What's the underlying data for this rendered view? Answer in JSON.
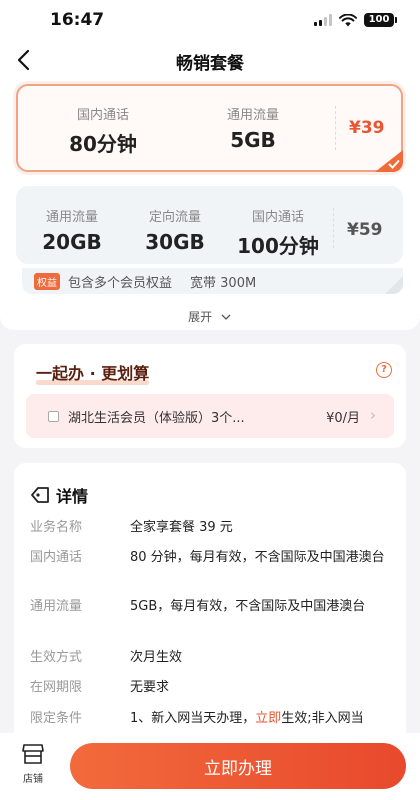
{
  "status_bar": {
    "time": "16:47",
    "battery": "100"
  },
  "nav": {
    "title": "畅销套餐"
  },
  "plans": [
    {
      "selected": true,
      "price": "¥39",
      "items": [
        {
          "label": "国内通话",
          "value": "80分钟"
        },
        {
          "label": "通用流量",
          "value": "5GB"
        }
      ]
    },
    {
      "selected": false,
      "price": "¥59",
      "items": [
        {
          "label": "通用流量",
          "value": "20GB"
        },
        {
          "label": "定向流量",
          "value": "30GB"
        },
        {
          "label": "国内通话",
          "value": "100分钟"
        }
      ],
      "benefits": {
        "badge": "权益",
        "items": [
          "包含多个会员权益",
          "宽带 300M"
        ]
      }
    }
  ],
  "expand_label": "展开",
  "together": {
    "title": "一起办 · 更划算",
    "help": "?",
    "addon": {
      "name": "湖北生活会员（体验版）3个...",
      "price": "¥0/月"
    }
  },
  "details": {
    "title": "详情",
    "rows": [
      {
        "key": "业务名称",
        "value": "全家享套餐 39 元"
      },
      {
        "key": "国内通话",
        "value": "80 分钟，每月有效，不含国际及中国港澳台"
      },
      {
        "key": "通用流量",
        "value": "5GB，每月有效，不含国际及中国港澳台"
      },
      {
        "key": "生效方式",
        "value": "次月生效"
      },
      {
        "key": "在网期限",
        "value": "无要求"
      },
      {
        "key": "限定条件",
        "value_parts": [
          "1、新入网当天办理，",
          "立即",
          "生效;非入网当"
        ]
      }
    ]
  },
  "bottom": {
    "store_label": "店铺",
    "cta_label": "立即办理"
  },
  "colors": {
    "accent": "#ef6b3c",
    "price_red": "#e8552f"
  }
}
